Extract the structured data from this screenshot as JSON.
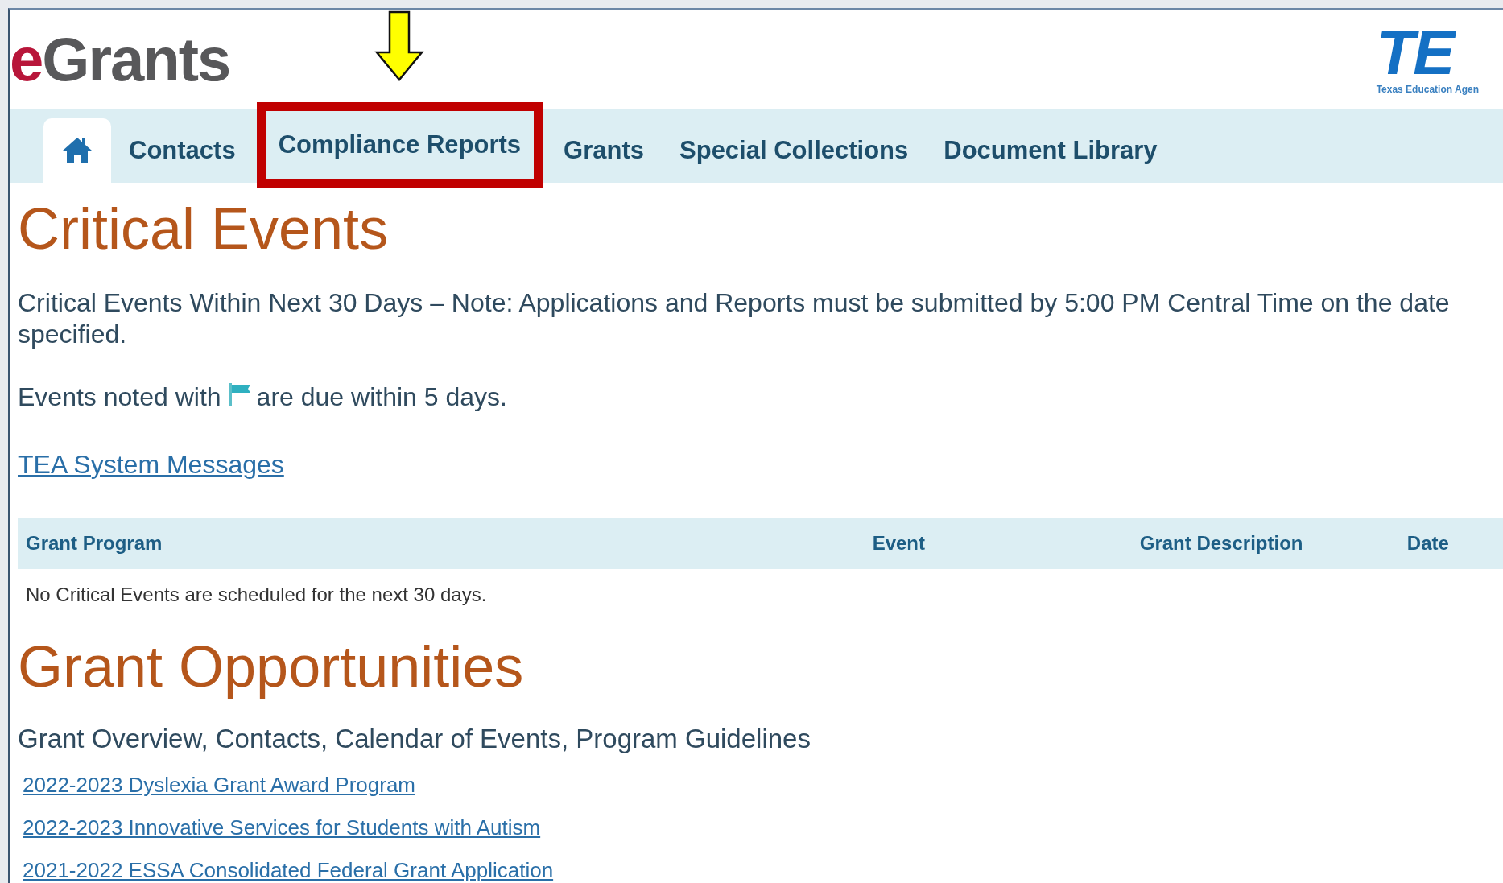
{
  "header": {
    "logo": "eGrants",
    "agency_logo": "TE",
    "agency_name": "Texas Education Agen"
  },
  "nav": [
    {
      "kind": "home",
      "selected": true,
      "highlighted": false
    },
    {
      "kind": "link",
      "label": "Contacts",
      "selected": false,
      "highlighted": false
    },
    {
      "kind": "link",
      "label": "Compliance Reports",
      "selected": false,
      "highlighted": true
    },
    {
      "kind": "link",
      "label": "Grants",
      "selected": false,
      "highlighted": false
    },
    {
      "kind": "link",
      "label": "Special Collections",
      "selected": false,
      "highlighted": false
    },
    {
      "kind": "link",
      "label": "Document Library",
      "selected": false,
      "highlighted": false
    }
  ],
  "critical_events": {
    "title": "Critical Events",
    "note": "Critical Events Within Next 30 Days – Note: Applications and Reports must be submitted by 5:00 PM Central Time on the date specified.",
    "flag_note_before": "Events noted with",
    "flag_note_after": "are due within 5 days.",
    "link": "TEA System Messages",
    "table": {
      "columns": [
        "Grant Program",
        "Event",
        "Grant Description",
        "Date"
      ],
      "empty_message": "No Critical Events are scheduled for the next 30 days."
    }
  },
  "grant_opportunities": {
    "title": "Grant Opportunities",
    "subtitle": "Grant Overview, Contacts, Calendar of Events, Program Guidelines",
    "links": [
      "2022-2023 Dyslexia Grant Award Program",
      "2022-2023 Innovative Services for Students with Autism",
      "2021-2022 ESSA Consolidated Federal Grant Application"
    ]
  }
}
